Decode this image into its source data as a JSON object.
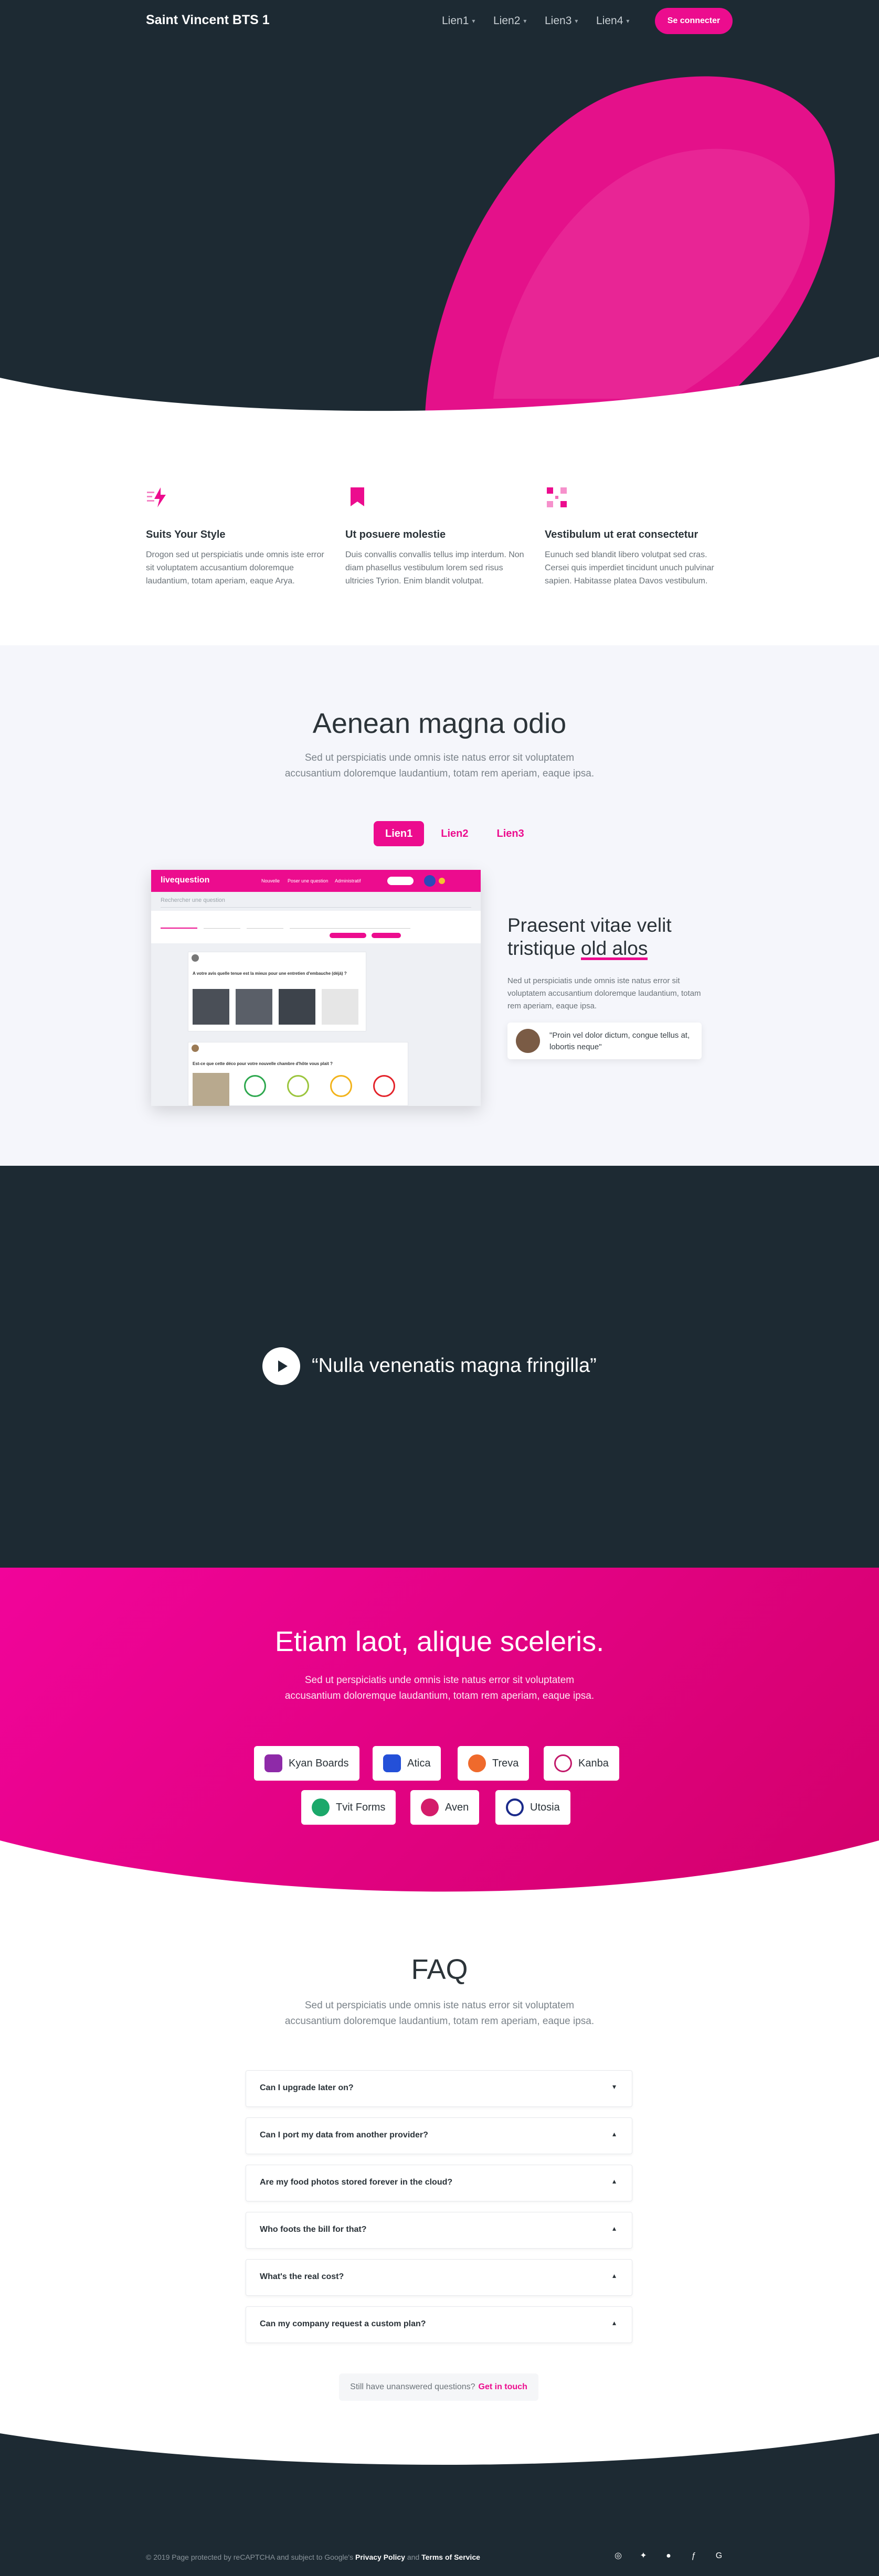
{
  "nav": {
    "brand": "Saint Vincent BTS 1",
    "links": [
      "Lien1",
      "Lien2",
      "Lien3",
      "Lien4"
    ],
    "cta": "Se connecter"
  },
  "features": [
    {
      "icon": "lightning-icon",
      "title": "Suits Your Style",
      "text": "Drogon sed ut perspiciatis unde omnis iste error sit voluptatem accusantium doloremque laudantium, totam aperiam, eaque Arya."
    },
    {
      "icon": "bookmark-icon",
      "title": "Ut posuere molestie",
      "text": "Duis convallis convallis tellus imp interdum. Non diam phasellus vestibulum lorem sed risus ultricies Tyrion. Enim blandit volutpat."
    },
    {
      "icon": "grid-icon",
      "title": "Vestibulum ut erat consectetur",
      "text": "Eunuch sed blandit libero volutpat sed cras. Cersei quis imperdiet tincidunt unuch pulvinar sapien. Habitasse platea Davos vestibulum."
    }
  ],
  "section2": {
    "title": "Aenean magna odio",
    "subtitle_line1": "Sed ut perspiciatis unde omnis iste natus error sit voluptatem",
    "subtitle_line2": "accusantium doloremque laudantium, totam rem aperiam, eaque ipsa.",
    "tabs": [
      "Lien1",
      "Lien2",
      "Lien3"
    ],
    "active_tab": "Lien1",
    "heading_line1": "Praesent vitae velit",
    "heading_line2_a": "tristique ",
    "heading_line2_b": "old alos",
    "text": "Ned ut perspiciatis unde omnis iste natus error sit voluptatem accusantium doloremque laudantium, totam rem aperiam, eaque ipsa.",
    "quote": "\"Proin vel dolor dictum, congue tellus at, lobortis neque\""
  },
  "mock": {
    "logo": "livequestion",
    "menu": [
      "Nouvelle",
      "Poser une question",
      "Administratif"
    ],
    "search_placeholder": "Rechercher une question",
    "card1_title": "A votre avis quelle tenue est la mieux pour une entretien d'embauche (déjà) ?",
    "card2_title": "Est-ce que cette déco pour votre nouvelle chambre d'hôte vous plait ?"
  },
  "video": {
    "quote": "“Nulla venenatis magna fringilla”"
  },
  "integrations": {
    "title": "Etiam laot, alique sceleris.",
    "subtitle_line1": "Sed ut perspiciatis unde omnis iste natus error sit voluptatem",
    "subtitle_line2": "accusantium doloremque laudantium, totam rem aperiam, eaque ipsa.",
    "brands": [
      "Kyan Boards",
      "Atica",
      "Treva",
      "Kanba",
      "Tvit Forms",
      "Aven",
      "Utosia"
    ],
    "brand_colors": [
      "#8e2aa8",
      "#2450d8",
      "#ef6a2c",
      "#c2186a",
      "#1ba86a",
      "#d41c6a",
      "#1a2a8a"
    ]
  },
  "faq": {
    "title": "FAQ",
    "subtitle_line1": "Sed ut perspiciatis unde omnis iste natus error sit voluptatem",
    "subtitle_line2": "accusantium doloremque laudantium, totam rem aperiam, eaque ipsa.",
    "questions": [
      "Can I upgrade later on?",
      "Can I port my data from another provider?",
      "Are my food photos stored forever in the cloud?",
      "Who foots the bill for that?",
      "What's the real cost?",
      "Can my company request a custom plan?"
    ],
    "more_text": "Still have unanswered questions?",
    "more_link": "Get in touch"
  },
  "footer": {
    "text_prefix": "© 2019 Page protected by reCAPTCHA and subject to Google's",
    "privacy": "Privacy Policy",
    "and": "and",
    "terms": "Terms of Service",
    "social": [
      "dribbble-icon",
      "twitter-icon",
      "github-icon",
      "facebook-icon",
      "google-icon"
    ]
  },
  "colors": {
    "accent": "#ec0c8e",
    "dark": "#1d2a33"
  }
}
